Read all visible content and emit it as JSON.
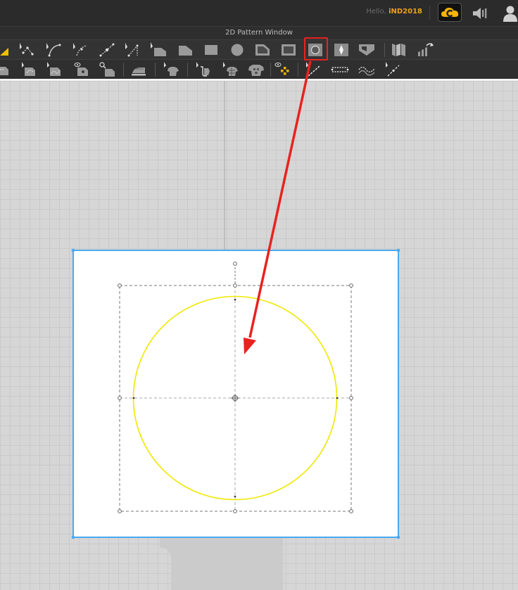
{
  "header": {
    "greeting": "Hello,",
    "username": "iND2018",
    "cloud_icon": "cloud-c-icon",
    "speaker_icon": "speaker-icon",
    "user_icon": "user-icon"
  },
  "window": {
    "title": "2D Pattern Window"
  },
  "toolbar_row_1": {
    "tools": [
      "triangle-corner-icon",
      "edit-point-icon",
      "edit-curve-point-icon",
      "curvature-icon",
      "add-point-icon",
      "edit-segment-icon",
      "select-pattern-icon",
      "polygon-icon",
      "rectangle-icon",
      "circle-filled-icon",
      "internal-polygon-icon",
      "internal-rectangle-icon",
      "internal-circle-icon",
      "dart-icon",
      "pleat-icon",
      "fold-icon",
      "unfold-icon"
    ],
    "selected_tool": "internal-circle-icon"
  },
  "toolbar_row_2": {
    "tools": [
      "sewing-icon",
      "segment-sewing-icon",
      "free-sewing-icon",
      "show-sewing-icon",
      "check-sewing-icon",
      "iron-icon",
      "show-garment-icon",
      "tack-icon",
      "pattern-3d-icon",
      "avatar-garment-icon",
      "show-hide-icon",
      "topstitch-icon",
      "piping-icon",
      "wave-line-icon",
      "fold-line-icon"
    ]
  },
  "colors": {
    "circle_stroke": "#f0e800",
    "pattern_border": "#4aaaf0",
    "annotation_red": "#e8231f",
    "username_gold": "#e8a317"
  }
}
